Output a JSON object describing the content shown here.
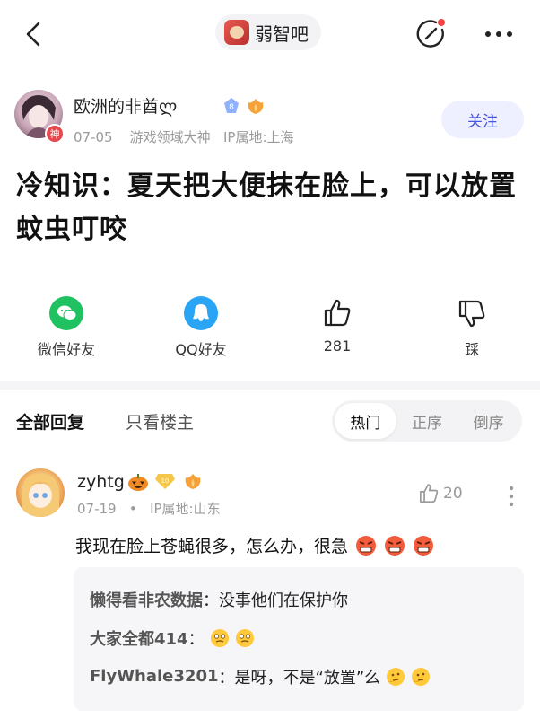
{
  "header": {
    "forum_name": "弱智吧",
    "icons": {
      "back": "back-arrow-icon",
      "edit": "edit-post-icon",
      "more": "more-horizontal-icon"
    },
    "notification_dot_color": "#f04545"
  },
  "author": {
    "name": "欧洲的非酋ლ",
    "avatar_badge": "神",
    "level": "8",
    "date": "07-05",
    "title": "游戏领域大神",
    "ip": "IP属地:上海",
    "follow_label": "关注"
  },
  "post": {
    "title": "冷知识：夏天把大便抹在脸上，可以放置蚊虫叮咬"
  },
  "actions": {
    "wechat_label": "微信好友",
    "qq_label": "QQ好友",
    "like_count": "281",
    "dislike_label": "踩"
  },
  "tabs": {
    "all": "全部回复",
    "op_only": "只看楼主",
    "sort": [
      "热门",
      "正序",
      "倒序"
    ],
    "active_sort": "热门"
  },
  "comment": {
    "user": "zyhtg",
    "level": "10",
    "date": "07-19",
    "separator": "•",
    "ip": "IP属地:山东",
    "likes": "20",
    "text": "我现在脸上苍蝇很多，怎么办，很急",
    "emoji": "angry-face-emoji",
    "replies": [
      {
        "name": "懒得看非农数据",
        "sep": "：",
        "text": "没事他们在保护你"
      },
      {
        "name": "大家全都414",
        "sep": "：",
        "text": ""
      },
      {
        "name": "FlyWhale3201",
        "sep": "：",
        "text": "是呀，不是“放置”么"
      }
    ]
  },
  "colors": {
    "accent": "#4a56d8",
    "follow_bg": "#eef0ff",
    "wechat": "#1fc160",
    "qq": "#2aa5f5",
    "muted": "#9a9a9a"
  }
}
